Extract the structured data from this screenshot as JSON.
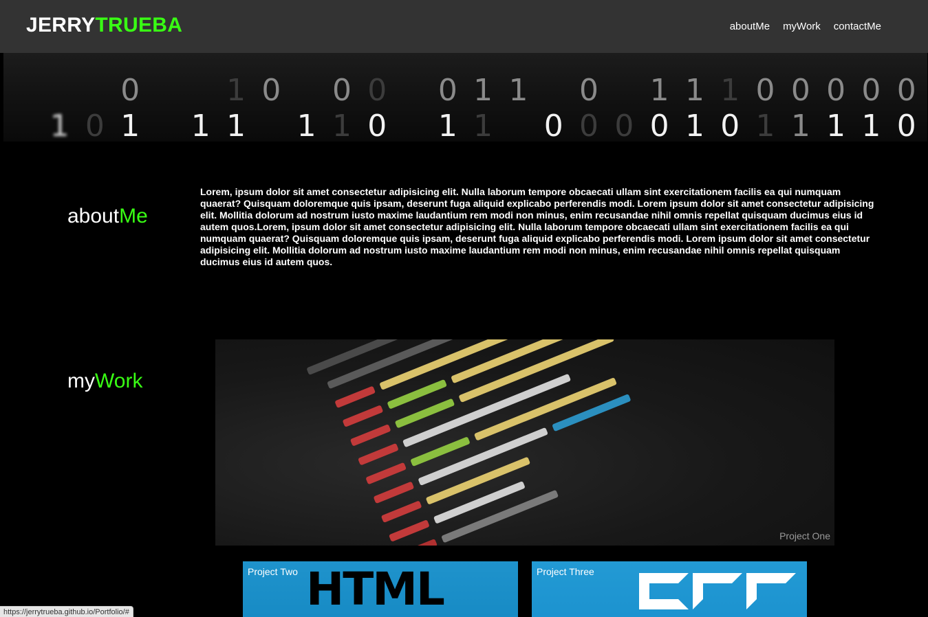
{
  "brand": {
    "first": "JERRY",
    "last": "TRUEBA"
  },
  "nav": [
    {
      "label": "aboutMe"
    },
    {
      "label": "myWork"
    },
    {
      "label": "contactMe"
    }
  ],
  "about": {
    "heading_white": "about",
    "heading_green": "Me",
    "text": "Lorem, ipsum dolor sit amet consectetur adipisicing elit. Nulla laborum tempore obcaecati ullam sint exercitationem facilis ea qui numquam quaerat? Quisquam doloremque quis ipsam, deserunt fuga aliquid explicabo perferendis modi. Lorem ipsum dolor sit amet consectetur adipisicing elit. Mollitia dolorum ad nostrum iusto maxime laudantium rem modi non minus, enim recusandae nihil omnis repellat quisquam ducimus eius id autem quos.Lorem, ipsum dolor sit amet consectetur adipisicing elit. Nulla laborum tempore obcaecati ullam sint exercitationem facilis ea qui numquam quaerat? Quisquam doloremque quis ipsam, deserunt fuga aliquid explicabo perferendis modi. Lorem ipsum dolor sit amet consectetur adipisicing elit. Mollitia dolorum ad nostrum iusto maxime laudantium rem modi non minus, enim recusandae nihil omnis repellat quisquam ducimus eius id autem quos."
  },
  "work": {
    "heading_white": "my",
    "heading_green": "Work",
    "projects": [
      {
        "label": "Project One"
      },
      {
        "label": "Project Two",
        "logo_text": "HTML"
      },
      {
        "label": "Project Three",
        "logo_text": "CSS"
      }
    ]
  },
  "status_url": "https://jerrytrueba.github.io/Portfolio/#",
  "colors": {
    "accent_green": "#39ff14",
    "navbar": "#333333",
    "background": "#000000",
    "card_blue": "#1e8dcb"
  }
}
